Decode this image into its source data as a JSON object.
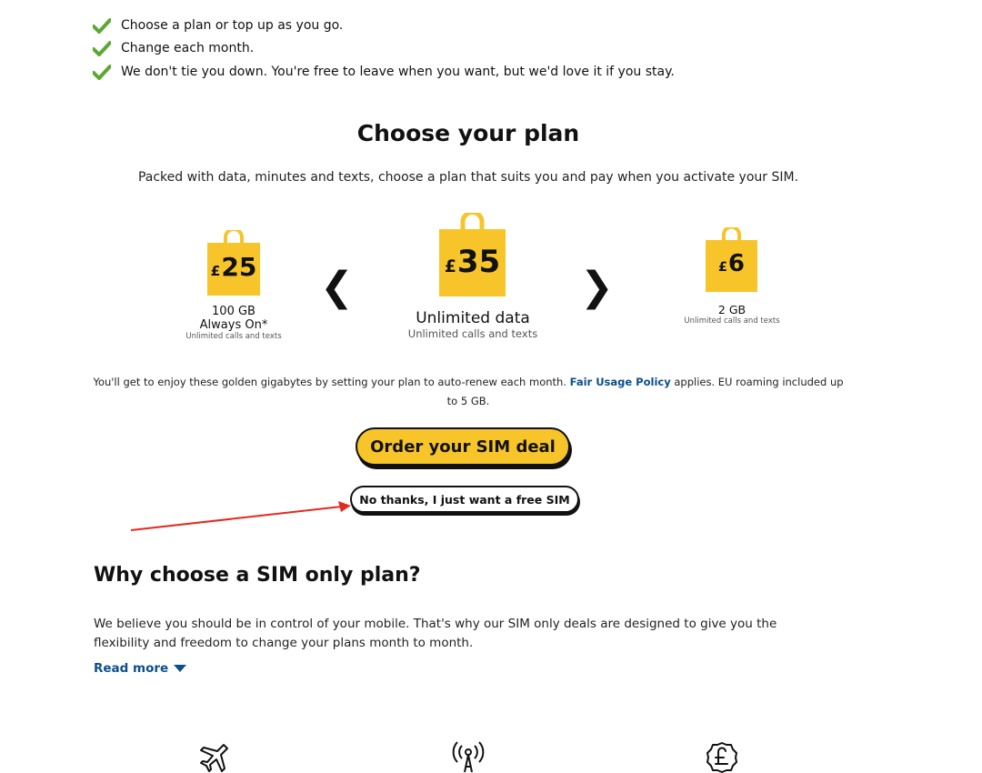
{
  "bullets": [
    "Choose a plan or top up as you go.",
    "Change each month.",
    "We don't tie you down. You're free to leave when you want, but we'd love it if you stay."
  ],
  "plans_section": {
    "title": "Choose your plan",
    "subtitle": "Packed with data, minutes and texts, choose a plan that suits you and pay when you activate your SIM.",
    "plans": [
      {
        "currency": "£",
        "amount": "25",
        "data": "100 GB",
        "extra": "Always On*",
        "note": "Unlimited calls and texts"
      },
      {
        "currency": "£",
        "amount": "35",
        "data": "Unlimited data",
        "note": "Unlimited calls and texts"
      },
      {
        "currency": "£",
        "amount": "6",
        "data": "2 GB",
        "note": "Unlimited calls and texts"
      }
    ],
    "prev_arrow": "❮",
    "next_arrow": "❯",
    "policy_text_before": "You'll get to enjoy these golden gigabytes by setting your plan to auto-renew each month. ",
    "policy_link": "Fair Usage Policy",
    "policy_text_after": " applies. EU roaming included up to 5 GB.",
    "order_button": "Order your SIM deal",
    "free_sim_button": "No thanks, I just want a free SIM"
  },
  "why_section": {
    "title": "Why choose a SIM only plan?",
    "paragraph": "We believe you should be in control of your mobile. That's why our SIM only deals are designed to give you the flexibility and freedom to change your plans month to month.",
    "read_more": "Read more"
  },
  "feature_icons": [
    "airplane-icon",
    "signal-tower-icon",
    "pound-coin-icon"
  ],
  "colors": {
    "accent_yellow": "#f7c42a",
    "check_green": "#5aa832",
    "link_blue": "#0b4f8a",
    "annotation_red": "#e32a1f"
  }
}
